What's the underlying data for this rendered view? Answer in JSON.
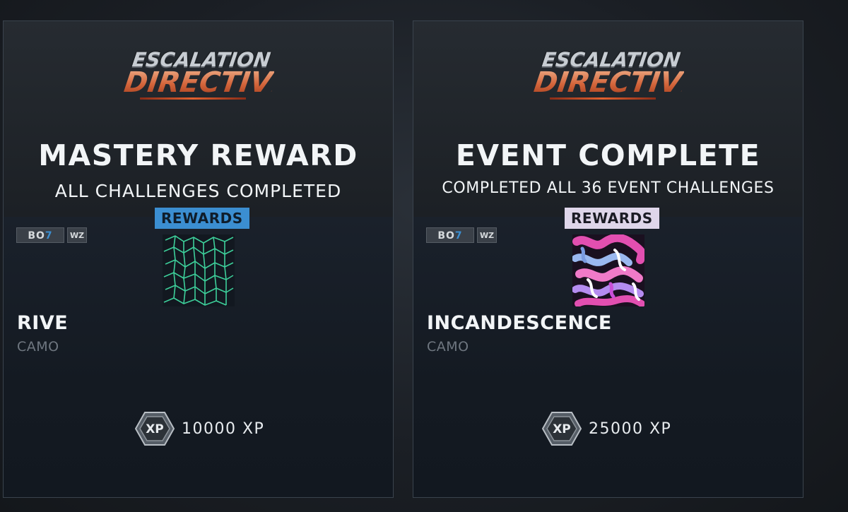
{
  "cards": [
    {
      "logo": {
        "line1": "ESCALATION",
        "line2": "DIRECTIVE"
      },
      "title": "MASTERY REWARD",
      "subtitle": "ALL CHALLENGES COMPLETED",
      "rewards_label": "REWARDS",
      "badges": {
        "game": "BO7",
        "wz": "WZ"
      },
      "item_name": "RIVE",
      "item_type": "CAMO",
      "xp_icon_label": "XP",
      "xp": "10000 XP",
      "rewards_tag_color": "#3b8ed1"
    },
    {
      "logo": {
        "line1": "ESCALATION",
        "line2": "DIRECTIVE"
      },
      "title": "EVENT COMPLETE",
      "subtitle": "COMPLETED ALL 36 EVENT CHALLENGES",
      "rewards_label": "REWARDS",
      "badges": {
        "game": "BO7",
        "wz": "WZ"
      },
      "item_name": "INCANDESCENCE",
      "item_type": "CAMO",
      "xp_icon_label": "XP",
      "xp": "25000 XP",
      "rewards_tag_color": "#dfd6ea"
    }
  ],
  "icons": {
    "xp": "xp-hexagon-icon",
    "camo_rive": "rive-camo-icon",
    "camo_incandescence": "incandescence-camo-icon"
  }
}
